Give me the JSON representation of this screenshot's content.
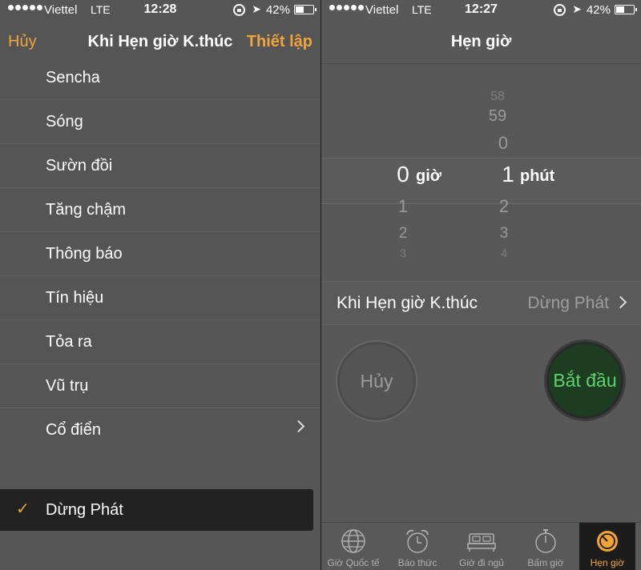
{
  "left": {
    "status": {
      "carrier": "Viettel",
      "network": "LTE",
      "time": "12:28",
      "battery": "42%",
      "battery_level": 0.42
    },
    "nav": {
      "cancel": "Hủy",
      "title": "Khi Hẹn giờ K.thúc",
      "set": "Thiết lập"
    },
    "tones": [
      {
        "label": "Sencha"
      },
      {
        "label": "Sóng"
      },
      {
        "label": "Sườn đồi"
      },
      {
        "label": "Tăng chậm"
      },
      {
        "label": "Thông báo"
      },
      {
        "label": "Tín hiệu"
      },
      {
        "label": "Tỏa ra"
      },
      {
        "label": "Vũ trụ"
      },
      {
        "label": "Cổ điển"
      }
    ],
    "selected": {
      "check": "✓",
      "label": "Dừng Phát"
    }
  },
  "right": {
    "status": {
      "carrier": "Viettel",
      "network": "LTE",
      "time": "12:27",
      "battery": "42%",
      "battery_level": 0.42
    },
    "title": "Hẹn giờ",
    "picker": {
      "hours": {
        "above": [
          "",
          "",
          ""
        ],
        "selected": "0",
        "below": [
          "1",
          "2",
          "3"
        ],
        "unit": "giờ"
      },
      "minutes": {
        "above": [
          "58",
          "59",
          "0"
        ],
        "selected": "1",
        "below": [
          "2",
          "3",
          "4"
        ],
        "unit": "phút"
      }
    },
    "alarm": {
      "label": "Khi Hẹn giờ K.thúc",
      "value": "Dừng Phát"
    },
    "buttons": {
      "cancel": "Hủy",
      "start": "Bắt đầu"
    },
    "tabs": [
      {
        "label": "Giờ Quốc tế",
        "icon": "globe-icon"
      },
      {
        "label": "Báo thức",
        "icon": "alarm-clock-icon"
      },
      {
        "label": "Giờ đi ngủ",
        "icon": "bed-icon"
      },
      {
        "label": "Bấm giờ",
        "icon": "stopwatch-icon"
      },
      {
        "label": "Hẹn giờ",
        "icon": "timer-icon",
        "active": true
      }
    ],
    "colors": {
      "accent": "#f0a43a",
      "start_green": "#5ed36c"
    }
  }
}
